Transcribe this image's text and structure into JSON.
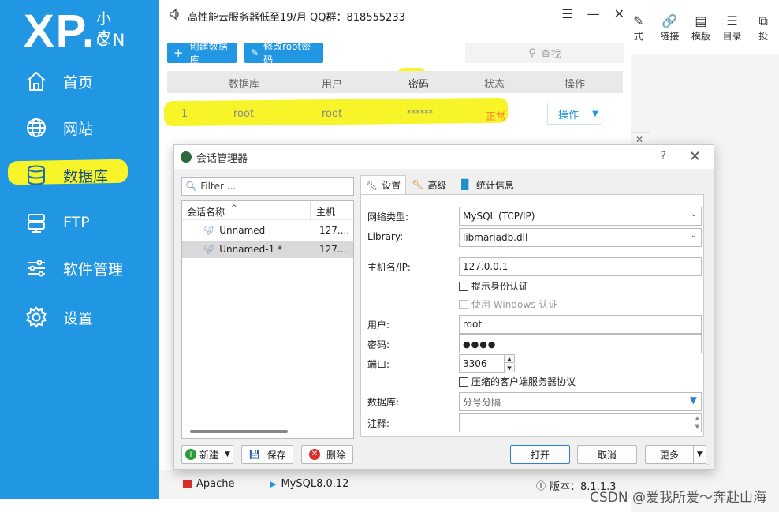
{
  "bg_toolbar": {
    "items": [
      "式",
      "链接",
      "模版",
      "目录",
      "投"
    ]
  },
  "watermark": "CSDN @爱我所爱～奔赴山海",
  "xp": {
    "logo": {
      "main": "XP.",
      "small": "小皮",
      "cn": "CN"
    },
    "nav": [
      {
        "label": "首页",
        "icon": "home-icon"
      },
      {
        "label": "网站",
        "icon": "globe-icon"
      },
      {
        "label": "数据库",
        "icon": "database-icon"
      },
      {
        "label": "FTP",
        "icon": "server-icon"
      },
      {
        "label": "软件管理",
        "icon": "sliders-icon"
      },
      {
        "label": "设置",
        "icon": "gear-icon"
      }
    ],
    "title": "高性能云服务器低至19/月  QQ群：818555233",
    "buttons": {
      "create_db": "创建数据库",
      "change_root": "修改root密码"
    },
    "search_placeholder": "查找",
    "table": {
      "headers": [
        "数据库",
        "用户",
        "密码",
        "状态",
        "操作"
      ],
      "row": {
        "index": "1",
        "database": "root",
        "user": "root",
        "password": "******",
        "status": "正常",
        "action": "操作"
      }
    },
    "status_bar": {
      "apache": "Apache",
      "mysql": "MySQL8.0.12",
      "version": "版本：8.1.1.3"
    }
  },
  "session": {
    "title": "会话管理器",
    "help": "?",
    "filter_placeholder": "Filter ...",
    "tree": {
      "col_name": "会话名称",
      "col_host": "主机",
      "rows": [
        {
          "name": "Unnamed",
          "host": "127...."
        },
        {
          "name": "Unnamed-1 *",
          "host": "127...."
        }
      ]
    },
    "buttons": {
      "new": "新建",
      "save": "保存",
      "delete": "删除",
      "open": "打开",
      "cancel": "取消",
      "more": "更多"
    },
    "tabs": [
      "设置",
      "高级",
      "统计信息"
    ],
    "labels": {
      "network_type": "网络类型:",
      "library": "Library:",
      "host": "主机名/IP:",
      "user": "用户:",
      "password": "密码:",
      "port": "端口:",
      "database": "数据库:",
      "comment": "注释:"
    },
    "values": {
      "network_type": "MySQL (TCP/IP)",
      "library": "libmariadb.dll",
      "host": "127.0.0.1",
      "user": "root",
      "password": "●●●●",
      "port": "3306",
      "database": "分号分隔",
      "comment": ""
    },
    "checks": {
      "prompt_auth": "提示身份认证",
      "windows_auth": "使用 Windows 认证",
      "compress": "压缩的客户端服务器协议"
    }
  }
}
